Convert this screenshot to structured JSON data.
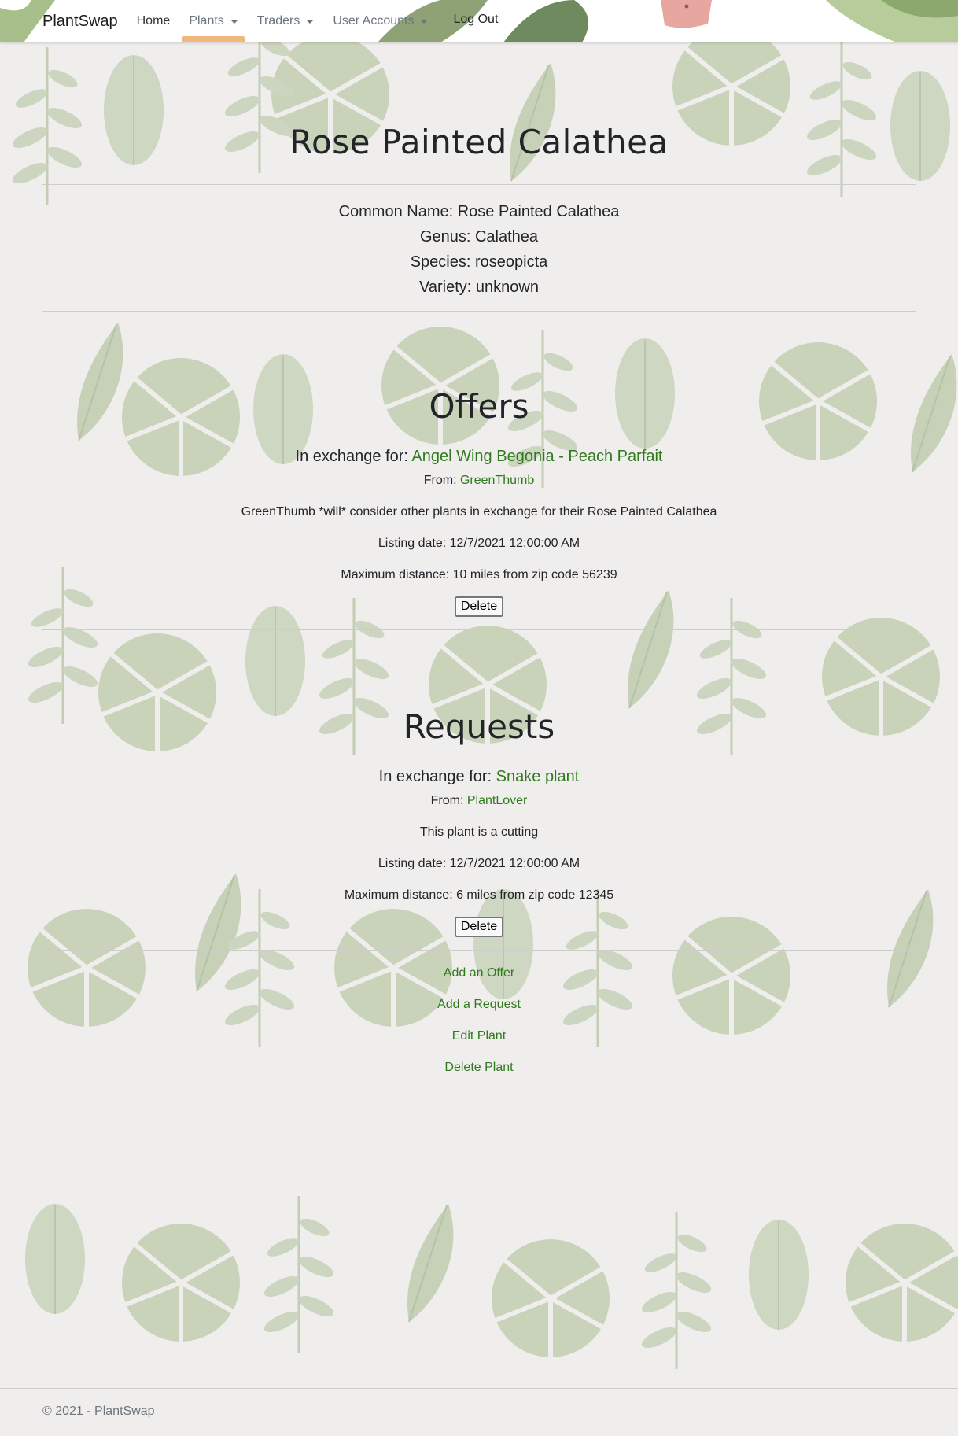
{
  "navbar": {
    "brand": "PlantSwap",
    "items": [
      {
        "label": "Home"
      },
      {
        "label": "Plants"
      },
      {
        "label": "Traders"
      },
      {
        "label": "User Accounts"
      }
    ],
    "logout": "Log Out",
    "accent_color": "#f1b77d"
  },
  "plant": {
    "title": "Rose Painted Calathea",
    "common_name": "Common Name: Rose Painted Calathea",
    "genus": "Genus: Calathea",
    "species": "Species: roseopicta",
    "variety": "Variety: unknown"
  },
  "offers": {
    "heading": "Offers",
    "items": [
      {
        "exchange_prefix": "In exchange for:",
        "exchange_plant": "Angel Wing Begonia - Peach Parfait",
        "from_prefix": "From:",
        "from_user": "GreenThumb",
        "note": "GreenThumb *will* consider other plants in exchange for their Rose Painted Calathea",
        "listing_date": "Listing date: 12/7/2021 12:00:00 AM",
        "max_distance": "Maximum distance: 10 miles from zip code 56239",
        "delete_label": "Delete"
      }
    ]
  },
  "requests": {
    "heading": "Requests",
    "items": [
      {
        "exchange_prefix": "In exchange for:",
        "exchange_plant": "Snake plant",
        "from_prefix": "From:",
        "from_user": "PlantLover",
        "note": "This plant is a cutting",
        "listing_date": "Listing date: 12/7/2021 12:00:00 AM",
        "max_distance": "Maximum distance: 6 miles from zip code 12345",
        "delete_label": "Delete"
      }
    ]
  },
  "actions": {
    "add_offer": "Add an Offer",
    "add_request": "Add a Request",
    "edit_plant": "Edit Plant",
    "delete_plant": "Delete Plant"
  },
  "footer": {
    "text": "© 2021 - PlantSwap"
  },
  "colors": {
    "link_green": "#2f7a1c",
    "background": "#f0eeed"
  }
}
